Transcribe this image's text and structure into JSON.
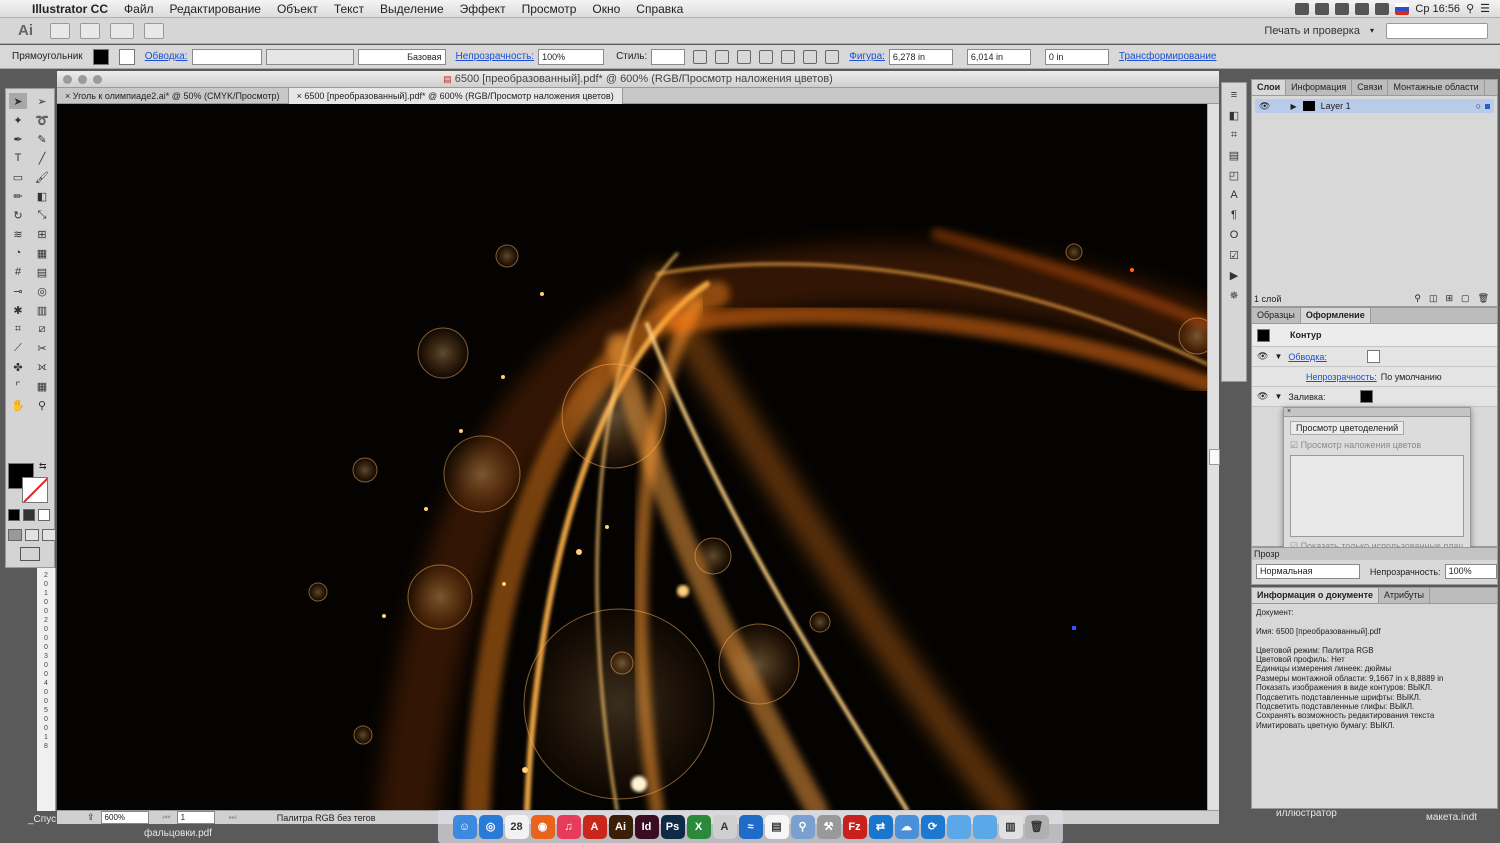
{
  "menubar": {
    "app": "Illustrator CC",
    "items": [
      "Файл",
      "Редактирование",
      "Объект",
      "Текст",
      "Выделение",
      "Эффект",
      "Просмотр",
      "Окно",
      "Справка"
    ],
    "clock": "Ср 16:56"
  },
  "appbar": {
    "logo": "Ai",
    "print_menu": "Печать и проверка"
  },
  "control": {
    "tool": "Прямоугольник",
    "stroke_link": "Обводка:",
    "stroke_style": "Базовая",
    "opacity_link": "Непрозрачность:",
    "opacity_value": "100%",
    "style_label": "Стиль:",
    "shape_link": "Фигура:",
    "width_value": "6,278 in",
    "height_value": "6,014 in",
    "corner_value": "0 in",
    "transform_link": "Трансформирование"
  },
  "window": {
    "title": "6500 [преобразованный].pdf* @ 600% (RGB/Просмотр наложения цветов)",
    "tabs": [
      {
        "label": "Уголь к олимпиаде2.ai* @ 50% (CMYK/Просмотр)"
      },
      {
        "label": "6500 [преобразованный].pdf* @ 600% (RGB/Просмотр наложения цветов)"
      }
    ]
  },
  "ruler": {
    "labels": [
      "2",
      "0",
      "1",
      "0",
      "0",
      "2",
      "0",
      "0",
      "0",
      "3",
      "0",
      "0",
      "4",
      "0",
      "0",
      "5",
      "0",
      "0",
      "1",
      "8"
    ]
  },
  "status": {
    "zoom": "600%",
    "artboard": "1",
    "profile": "Палитра RGB без тегов"
  },
  "layers": {
    "tabs": [
      "Слои",
      "Информация",
      "Связи",
      "Монтажные области"
    ],
    "layer_name": "Layer 1",
    "count": "1 слой"
  },
  "appearance": {
    "tabs": [
      "Образцы",
      "Оформление"
    ],
    "object": "Контур",
    "stroke_link": "Обводка:",
    "opacity_link": "Непрозрачность:",
    "opacity_value": "По умолчанию",
    "fill_label": "Заливка:"
  },
  "separations": {
    "title": "Просмотр цветоделений",
    "overprint": "Просмотр наложения цветов",
    "used_only": "Показать только использованные плаш"
  },
  "transparency": {
    "title": "Прозр",
    "mode": "Нормальная",
    "opacity_label": "Непрозрачность:",
    "opacity_value": "100%"
  },
  "docinfo": {
    "tabs": [
      "Информация о документе",
      "Атрибуты"
    ],
    "lines": [
      "Документ:",
      "",
      "Имя: 6500 [преобразованный].pdf",
      "",
      "Цветовой режим: Палитра RGB",
      "Цветовой профиль: Нет",
      "Единицы измерения линеек: дюймы",
      "Размеры монтажной области: 9,1667 in x 8,8889 in",
      "Показать изображения в виде контуров: ВЫКЛ.",
      "Подсветить подставленные шрифты: ВЫКЛ.",
      "Подсветить подставленные глифы: ВЫКЛ.",
      "Сохранять возможность редактирования текста",
      "Имитировать цветную бумагу: ВЫКЛ."
    ]
  },
  "desktop": {
    "left1": "_Спус",
    "left2": "фальцовки.pdf",
    "right1": "иллюстратор",
    "right2": "макета.indt"
  },
  "dock": [
    {
      "icon": "finder-icon",
      "glyph": "☺",
      "color": "#3b8ae0"
    },
    {
      "icon": "safari-icon",
      "glyph": "◎",
      "color": "#2a7bd6"
    },
    {
      "icon": "calendar-icon",
      "glyph": "28",
      "color": "#f2f2f2"
    },
    {
      "icon": "firefox-icon",
      "glyph": "◉",
      "color": "#e8641c"
    },
    {
      "icon": "itunes-icon",
      "glyph": "♫",
      "color": "#e83a5a"
    },
    {
      "icon": "acrobat-icon",
      "glyph": "A",
      "color": "#c9261c"
    },
    {
      "icon": "illustrator-icon",
      "glyph": "Ai",
      "color": "#3a1e08"
    },
    {
      "icon": "indesign-icon",
      "glyph": "Id",
      "color": "#3a0d22"
    },
    {
      "icon": "photoshop-icon",
      "glyph": "Ps",
      "color": "#0e2a45"
    },
    {
      "icon": "excel-icon",
      "glyph": "X",
      "color": "#2a8a3a"
    },
    {
      "icon": "fontbook-icon",
      "glyph": "A",
      "color": "#cfcfcf"
    },
    {
      "icon": "network-icon",
      "glyph": "≈",
      "color": "#1e6bc8"
    },
    {
      "icon": "preview-icon",
      "glyph": "▤",
      "color": "#f6f6f6"
    },
    {
      "icon": "search-tool-icon",
      "glyph": "⚲",
      "color": "#7aa0d0"
    },
    {
      "icon": "utility-icon",
      "glyph": "⚒",
      "color": "#999999"
    },
    {
      "icon": "filezilla-icon",
      "glyph": "Fz",
      "color": "#c8201c"
    },
    {
      "icon": "teamviewer-icon",
      "glyph": "⇄",
      "color": "#1a75cc"
    },
    {
      "icon": "cloud-icon",
      "glyph": "☁",
      "color": "#4a90d8"
    },
    {
      "icon": "sync-icon",
      "glyph": "⟳",
      "color": "#1d78d0"
    },
    {
      "icon": "folder-icon",
      "glyph": "",
      "color": "#5aa8e8"
    },
    {
      "icon": "folder-icon",
      "glyph": "",
      "color": "#5aa8e8"
    },
    {
      "icon": "archive-icon",
      "glyph": "▥",
      "color": "#e0e0e0"
    },
    {
      "icon": "trash-icon",
      "glyph": "🗑",
      "color": "#b0b0b0"
    }
  ],
  "colors": {
    "canvas": "#050302",
    "glow": "#ff8a1e",
    "link": "#1a4fd6",
    "selection": "#b8cbe8"
  }
}
